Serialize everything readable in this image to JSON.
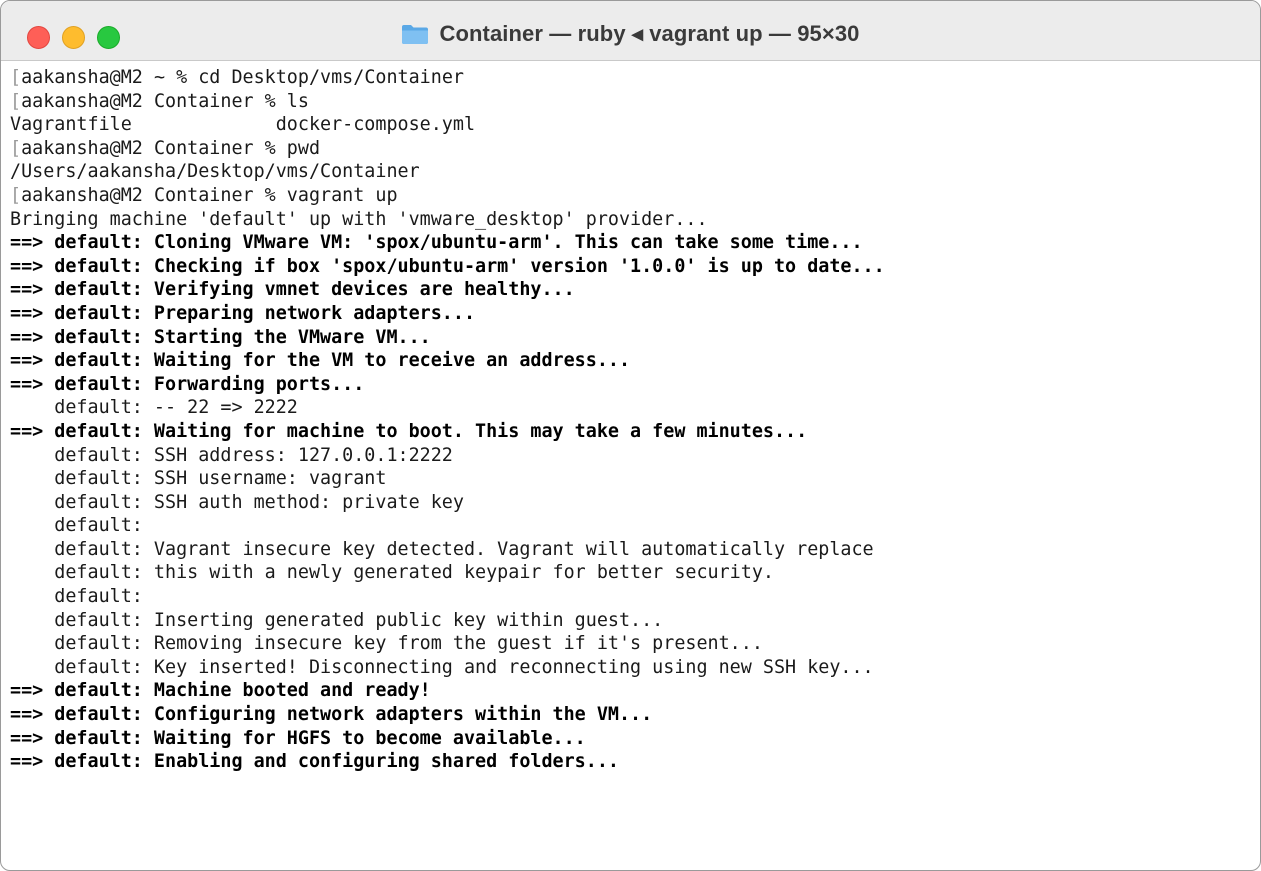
{
  "window": {
    "title": "Container — ruby ◂ vagrant up — 95×30"
  },
  "colors": {
    "close": "#fe5f57",
    "minimize": "#febc2e",
    "zoom": "#28c840",
    "folder": "#5aa8e6"
  },
  "icons": {
    "folder": "folder-icon",
    "close": "close-icon",
    "minimize": "minimize-icon",
    "zoom": "zoom-icon"
  },
  "terminal": {
    "lines": [
      {
        "text": "aakansha@M2 ~ % cd Desktop/vms/Container",
        "bold": false,
        "mark": true
      },
      {
        "text": "aakansha@M2 Container % ls",
        "bold": false,
        "mark": true
      },
      {
        "text": "Vagrantfile             docker-compose.yml",
        "bold": false,
        "mark": false
      },
      {
        "text": "aakansha@M2 Container % pwd",
        "bold": false,
        "mark": true
      },
      {
        "text": "/Users/aakansha/Desktop/vms/Container",
        "bold": false,
        "mark": false
      },
      {
        "text": "aakansha@M2 Container % vagrant up",
        "bold": false,
        "mark": true
      },
      {
        "text": "Bringing machine 'default' up with 'vmware_desktop' provider...",
        "bold": false,
        "mark": false
      },
      {
        "text": "==> default: Cloning VMware VM: 'spox/ubuntu-arm'. This can take some time...",
        "bold": true,
        "mark": false
      },
      {
        "text": "==> default: Checking if box 'spox/ubuntu-arm' version '1.0.0' is up to date...",
        "bold": true,
        "mark": false
      },
      {
        "text": "==> default: Verifying vmnet devices are healthy...",
        "bold": true,
        "mark": false
      },
      {
        "text": "==> default: Preparing network adapters...",
        "bold": true,
        "mark": false
      },
      {
        "text": "==> default: Starting the VMware VM...",
        "bold": true,
        "mark": false
      },
      {
        "text": "==> default: Waiting for the VM to receive an address...",
        "bold": true,
        "mark": false
      },
      {
        "text": "==> default: Forwarding ports...",
        "bold": true,
        "mark": false
      },
      {
        "text": "    default: -- 22 => 2222",
        "bold": false,
        "mark": false
      },
      {
        "text": "==> default: Waiting for machine to boot. This may take a few minutes...",
        "bold": true,
        "mark": false
      },
      {
        "text": "    default: SSH address: 127.0.0.1:2222",
        "bold": false,
        "mark": false
      },
      {
        "text": "    default: SSH username: vagrant",
        "bold": false,
        "mark": false
      },
      {
        "text": "    default: SSH auth method: private key",
        "bold": false,
        "mark": false
      },
      {
        "text": "    default:",
        "bold": false,
        "mark": false
      },
      {
        "text": "    default: Vagrant insecure key detected. Vagrant will automatically replace",
        "bold": false,
        "mark": false
      },
      {
        "text": "    default: this with a newly generated keypair for better security.",
        "bold": false,
        "mark": false
      },
      {
        "text": "    default:",
        "bold": false,
        "mark": false
      },
      {
        "text": "    default: Inserting generated public key within guest...",
        "bold": false,
        "mark": false
      },
      {
        "text": "    default: Removing insecure key from the guest if it's present...",
        "bold": false,
        "mark": false
      },
      {
        "text": "    default: Key inserted! Disconnecting and reconnecting using new SSH key...",
        "bold": false,
        "mark": false
      },
      {
        "text": "==> default: Machine booted and ready!",
        "bold": true,
        "mark": false
      },
      {
        "text": "==> default: Configuring network adapters within the VM...",
        "bold": true,
        "mark": false
      },
      {
        "text": "==> default: Waiting for HGFS to become available...",
        "bold": true,
        "mark": false
      },
      {
        "text": "==> default: Enabling and configuring shared folders...",
        "bold": true,
        "mark": false
      }
    ]
  }
}
